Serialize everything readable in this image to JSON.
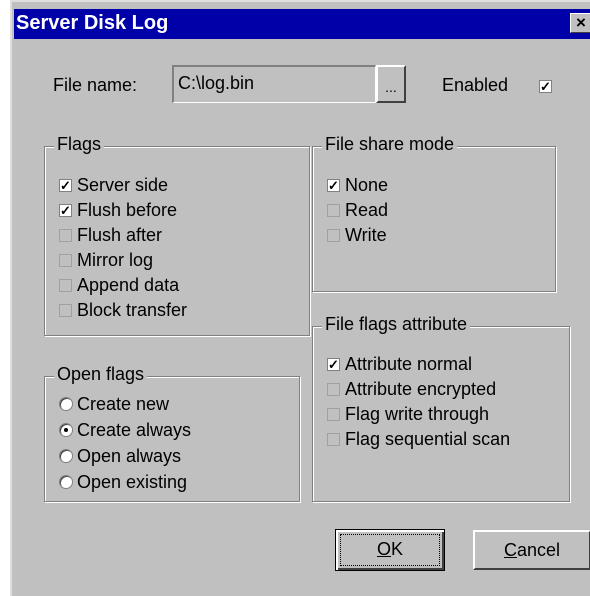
{
  "window": {
    "title": "Server Disk Log",
    "close_label": "×"
  },
  "file": {
    "label": "File name:",
    "value": "C:\\log.bin",
    "browse_label": "...",
    "enabled_label": "Enabled",
    "enabled_checked": true
  },
  "flags": {
    "title": "Flags",
    "items": [
      {
        "label": "Server side",
        "checked": true
      },
      {
        "label": "Flush before",
        "checked": true
      },
      {
        "label": "Flush after",
        "checked": false
      },
      {
        "label": "Mirror log",
        "checked": false
      },
      {
        "label": "Append data",
        "checked": false
      },
      {
        "label": "Block transfer",
        "checked": false
      }
    ]
  },
  "share_mode": {
    "title": "File share mode",
    "items": [
      {
        "label": "None",
        "checked": true
      },
      {
        "label": "Read",
        "checked": false
      },
      {
        "label": "Write",
        "checked": false
      }
    ]
  },
  "flags_attribute": {
    "title": "File flags attribute",
    "items": [
      {
        "label": "Attribute normal",
        "checked": true
      },
      {
        "label": "Attribute encrypted",
        "checked": false
      },
      {
        "label": "Flag write through",
        "checked": false
      },
      {
        "label": "Flag sequential scan",
        "checked": false
      }
    ]
  },
  "open_flags": {
    "title": "Open flags",
    "items": [
      {
        "label": "Create new",
        "selected": false
      },
      {
        "label": "Create always",
        "selected": true
      },
      {
        "label": "Open always",
        "selected": false
      },
      {
        "label": "Open existing",
        "selected": false
      }
    ]
  },
  "buttons": {
    "ok_prefix": "O",
    "ok_rest": "K",
    "cancel_prefix": "C",
    "cancel_rest": "ancel"
  },
  "colors": {
    "titlebar": "#0000a8",
    "face": "#c0c0c0"
  }
}
